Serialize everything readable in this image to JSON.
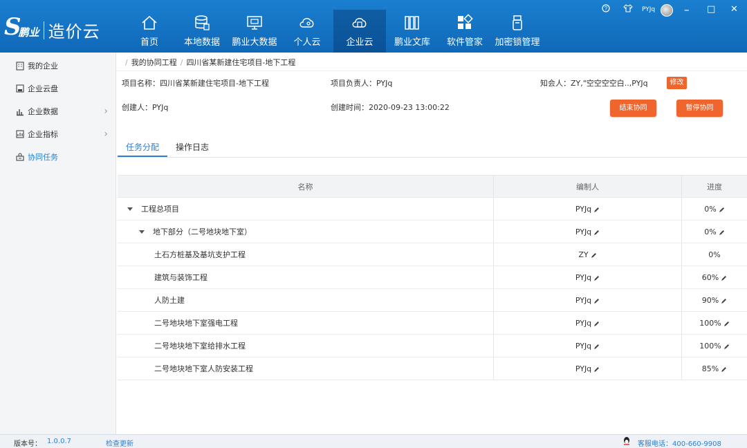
{
  "app": {
    "logo_mark": "S",
    "logo_brand": "鹏业",
    "product": "造价云"
  },
  "nav": [
    {
      "label": "首页",
      "icon": "home-icon"
    },
    {
      "label": "本地数据",
      "icon": "database-icon"
    },
    {
      "label": "鹏业大数据",
      "icon": "monitor-icon"
    },
    {
      "label": "个人云",
      "icon": "personal-cloud-icon"
    },
    {
      "label": "企业云",
      "icon": "enterprise-cloud-icon",
      "active": true
    },
    {
      "label": "鹏业文库",
      "icon": "library-icon"
    },
    {
      "label": "软件管家",
      "icon": "apps-icon"
    },
    {
      "label": "加密锁管理",
      "icon": "usb-key-icon"
    }
  ],
  "window": {
    "help": "?",
    "skin": "shirt-icon",
    "user": "PYJq",
    "minimize": "–",
    "maximize": "□",
    "close": "✕"
  },
  "sidebar": {
    "items": [
      {
        "label": "我的企业",
        "icon": "building-icon",
        "chevron": false
      },
      {
        "label": "企业云盘",
        "icon": "disk-icon",
        "chevron": false
      },
      {
        "label": "企业数据",
        "icon": "bar-chart-icon",
        "chevron": true
      },
      {
        "label": "企业指标",
        "icon": "index-chart-icon",
        "chevron": true
      },
      {
        "label": "协同任务",
        "icon": "collab-icon",
        "chevron": false,
        "active": true
      }
    ]
  },
  "breadcrumb": {
    "root": "我的协同工程",
    "current": "四川省某新建住宅项目-地下工程"
  },
  "project": {
    "name_label": "项目名称：四川省某新建住宅项目-地下工程",
    "owner_label": "项目负责人：PYJq",
    "notify_label": "知会人：ZY,\"空空空空白..,PYJq",
    "edit_btn": "修改",
    "creator_label": "创建人：PYJq",
    "created_label": "创建时间：2020-09-23 13:00:22",
    "end_btn": "结束协同",
    "pause_btn": "暂停协同"
  },
  "tabs": [
    {
      "label": "任务分配",
      "active": true
    },
    {
      "label": "操作日志",
      "active": false
    }
  ],
  "table": {
    "headers": [
      "名称",
      "编制人",
      "进度"
    ],
    "rows": [
      {
        "name": "工程总项目",
        "level": 0,
        "expand": true,
        "editor": "PYJq",
        "editor_editable": true,
        "progress": "0%",
        "progress_editable": true
      },
      {
        "name": "地下部分（二号地块地下室）",
        "level": 1,
        "expand": true,
        "editor": "PYJq",
        "editor_editable": true,
        "progress": "0%",
        "progress_editable": true
      },
      {
        "name": "土石方桩基及基坑支护工程",
        "level": 2,
        "expand": false,
        "editor": "ZY",
        "editor_editable": true,
        "progress": "0%",
        "progress_editable": false
      },
      {
        "name": "建筑与装饰工程",
        "level": 2,
        "expand": false,
        "editor": "PYJq",
        "editor_editable": true,
        "progress": "60%",
        "progress_editable": true
      },
      {
        "name": "人防土建",
        "level": 2,
        "expand": false,
        "editor": "PYJq",
        "editor_editable": true,
        "progress": "90%",
        "progress_editable": true
      },
      {
        "name": "二号地块地下室强电工程",
        "level": 2,
        "expand": false,
        "editor": "PYJq",
        "editor_editable": true,
        "progress": "100%",
        "progress_editable": true
      },
      {
        "name": "二号地块地下室给排水工程",
        "level": 2,
        "expand": false,
        "editor": "PYJq",
        "editor_editable": true,
        "progress": "100%",
        "progress_editable": true
      },
      {
        "name": "二号地块地下室人防安装工程",
        "level": 2,
        "expand": false,
        "editor": "PYJq",
        "editor_editable": true,
        "progress": "85%",
        "progress_editable": true
      }
    ]
  },
  "footer": {
    "version_label": "版本号：",
    "version": "1.0.0.7",
    "update": "检查更新",
    "hotline": "客服电话：400-660-9908"
  },
  "colors": {
    "topbar": "#1a7fd0",
    "accent": "#2d7fd3",
    "orange": "#f0652d"
  }
}
